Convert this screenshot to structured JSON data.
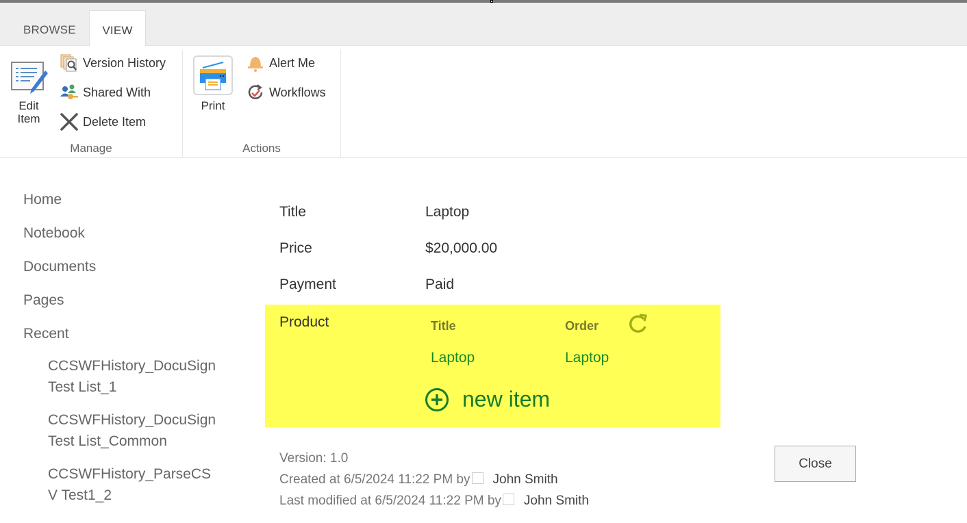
{
  "tabs": [
    {
      "label": "BROWSE",
      "active": false
    },
    {
      "label": "VIEW",
      "active": true
    }
  ],
  "ribbon": {
    "manage": {
      "label": "Manage",
      "edit_item": "Edit Item",
      "version_history": "Version History",
      "shared_with": "Shared With",
      "delete_item": "Delete Item"
    },
    "actions": {
      "label": "Actions",
      "print": "Print",
      "alert_me": "Alert Me",
      "workflows": "Workflows"
    }
  },
  "nav": {
    "items": [
      "Home",
      "Notebook",
      "Documents",
      "Pages",
      "Recent"
    ],
    "recent": [
      "CCSWFHistory_DocuSign Test List_1",
      "CCSWFHistory_DocuSign Test List_Common",
      "CCSWFHistory_ParseCSV Test1_2"
    ]
  },
  "fields": [
    {
      "label": "Title",
      "value": "Laptop"
    },
    {
      "label": "Price",
      "value": "$20,000.00"
    },
    {
      "label": "Payment",
      "value": "Paid"
    }
  ],
  "product": {
    "label": "Product",
    "columns": [
      "Title",
      "Order"
    ],
    "rows": [
      [
        "Laptop",
        "Laptop"
      ]
    ],
    "new_item": "new item",
    "highlight_color": "#ffff55",
    "link_color": "#17892a"
  },
  "meta": {
    "version": "Version: 1.0",
    "created_prefix": "Created at 6/5/2024 11:22 PM  by",
    "created_by": "John Smith",
    "modified_prefix": "Last modified at 6/5/2024 11:22 PM  by",
    "modified_by": "John Smith"
  },
  "close_label": "Close"
}
